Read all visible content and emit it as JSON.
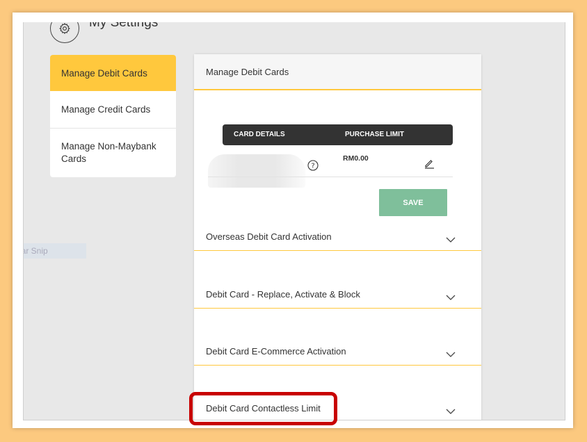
{
  "header": {
    "title": "My Settings",
    "icon": "gear-icon"
  },
  "sidebar": {
    "items": [
      {
        "label": "Manage Debit Cards",
        "active": true
      },
      {
        "label": "Manage Credit Cards",
        "active": false
      },
      {
        "label": "Manage Non-Maybank Cards",
        "active": false
      }
    ]
  },
  "snip_label": "lar Snip",
  "panel": {
    "title": "Manage Debit Cards",
    "table": {
      "columns": [
        "CARD DETAILS",
        "PURCHASE LIMIT"
      ],
      "rows": [
        {
          "purchase_limit": "RM0.00"
        }
      ]
    },
    "save_label": "SAVE",
    "accordions": [
      "Overseas Debit Card Activation",
      "Debit Card - Replace, Activate & Block",
      "Debit Card E-Commerce Activation",
      "Debit Card Contactless Limit"
    ]
  },
  "colors": {
    "accent": "#ffc83d",
    "save": "#7fbf9b",
    "highlight": "#c80000",
    "background": "#fcc97f"
  }
}
